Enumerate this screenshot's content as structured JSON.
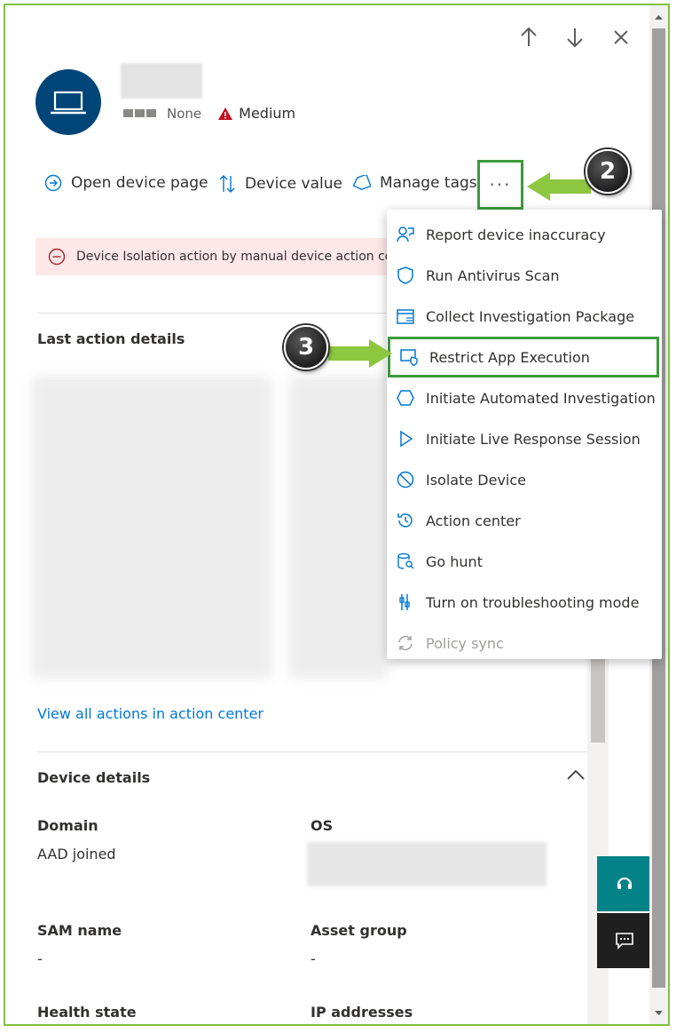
{
  "device": {
    "tag_label": "None",
    "severity_label": "Medium",
    "severity_color": "#c50f1f"
  },
  "toolbar": {
    "open_device_page": "Open device page",
    "device_value": "Device value",
    "manage_tags": "Manage tags",
    "more": "···"
  },
  "banner": {
    "text": "Device Isolation action by manual device action com"
  },
  "sections": {
    "last_action_details": "Last action details",
    "view_all_actions": "View all actions in action center",
    "device_details": "Device details"
  },
  "details": {
    "domain_label": "Domain",
    "domain_value": "AAD joined",
    "os_label": "OS",
    "sam_label": "SAM name",
    "sam_value": "-",
    "asset_group_label": "Asset group",
    "asset_group_value": "-",
    "health_label": "Health state",
    "ip_label": "IP addresses"
  },
  "menu": {
    "items": [
      {
        "label": "Report device inaccuracy",
        "icon": "report-person-icon"
      },
      {
        "label": "Run Antivirus Scan",
        "icon": "shield-icon"
      },
      {
        "label": "Collect Investigation Package",
        "icon": "collect-package-icon"
      },
      {
        "label": "Restrict App Execution",
        "icon": "restrict-app-icon"
      },
      {
        "label": "Initiate Automated Investigation",
        "icon": "hexagon-icon"
      },
      {
        "label": "Initiate Live Response Session",
        "icon": "play-icon"
      },
      {
        "label": "Isolate Device",
        "icon": "block-icon"
      },
      {
        "label": "Action center",
        "icon": "history-icon"
      },
      {
        "label": "Go hunt",
        "icon": "hunt-icon"
      },
      {
        "label": "Turn on troubleshooting mode",
        "icon": "wrench-icon"
      },
      {
        "label": "Policy sync",
        "icon": "sync-icon",
        "disabled": true
      }
    ]
  },
  "callouts": {
    "step2": "2",
    "step3": "3"
  },
  "colors": {
    "accent": "#0078d4",
    "highlight": "#3b9b3b",
    "arrow": "#8dc63f",
    "avatar": "#004578",
    "teal_button": "#038387"
  }
}
